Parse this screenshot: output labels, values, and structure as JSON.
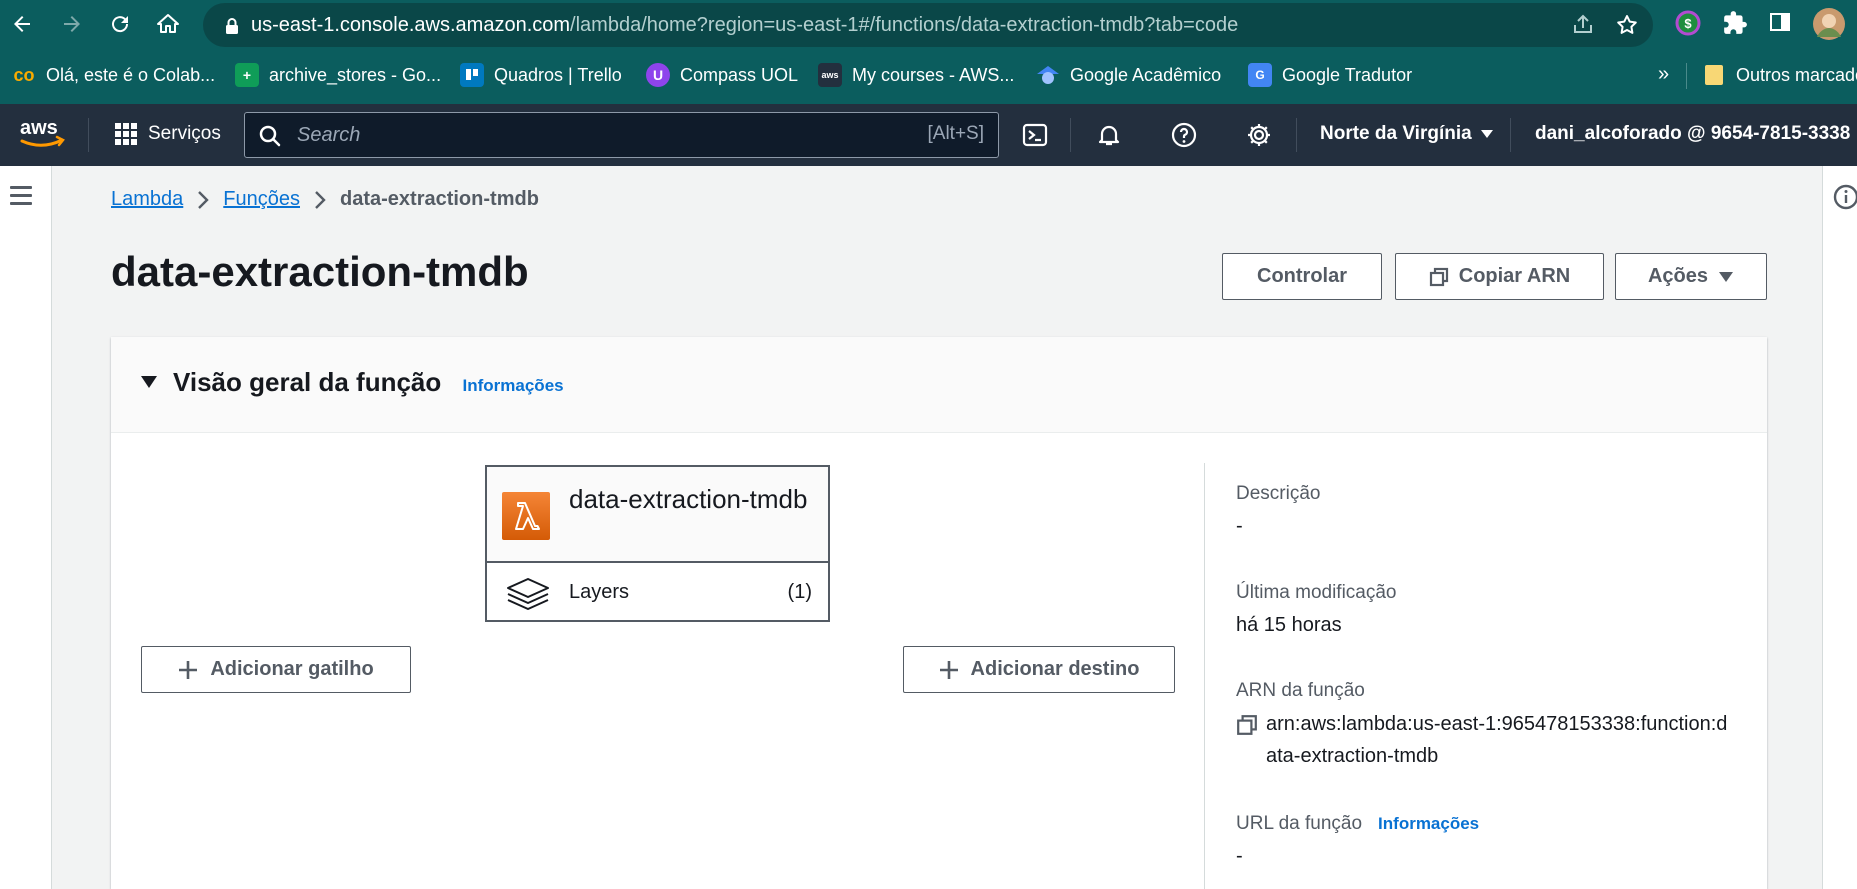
{
  "browser": {
    "url_host": "us-east-1.console.aws.amazon.com",
    "url_path": "/lambda/home?region=us-east-1#/functions/data-extraction-tmdb?tab=code",
    "bookmarks": [
      {
        "label": "Olá, este é o Colab...",
        "icon": "colab-icon"
      },
      {
        "label": "archive_stores - Go...",
        "icon": "sheets-icon"
      },
      {
        "label": "Quadros | Trello",
        "icon": "trello-icon"
      },
      {
        "label": "Compass UOL",
        "icon": "compass-icon"
      },
      {
        "label": "My courses - AWS...",
        "icon": "aws-icon"
      },
      {
        "label": "Google Acadêmico",
        "icon": "scholar-icon"
      },
      {
        "label": "Google Tradutor",
        "icon": "translate-icon"
      }
    ],
    "more_bookmarks": "»",
    "other_bookmarks": "Outros marcadores"
  },
  "awsnav": {
    "services_label": "Serviços",
    "search_placeholder": "Search",
    "search_shortcut": "[Alt+S]",
    "region": "Norte da Virgínia",
    "account": "dani_alcoforado @ 9654-7815-3338"
  },
  "breadcrumb": {
    "lambda": "Lambda",
    "functions": "Funções",
    "current": "data-extraction-tmdb"
  },
  "page": {
    "title": "data-extraction-tmdb",
    "buttons": {
      "throttle": "Controlar",
      "copy_arn": "Copiar ARN",
      "actions": "Ações"
    }
  },
  "overview": {
    "title": "Visão geral da função",
    "info_link": "Informações",
    "function_name": "data-extraction-tmdb",
    "layers_label": "Layers",
    "layers_count": "(1)",
    "add_trigger": "Adicionar gatilho",
    "add_destination": "Adicionar destino",
    "details": {
      "description_label": "Descrição",
      "description_value": "-",
      "last_modified_label": "Última modificação",
      "last_modified_value": "há 15 horas",
      "arn_label": "ARN da função",
      "arn_value": "arn:aws:lambda:us-east-1:965478153338:function:data-extraction-tmdb",
      "url_label": "URL da função",
      "url_info_link": "Informações",
      "url_value": "-"
    }
  },
  "colors": {
    "chrome": "#0b5d5e",
    "aws_nav": "#232f3e",
    "link": "#0972d3",
    "lambda_orange": "#d45b07"
  }
}
